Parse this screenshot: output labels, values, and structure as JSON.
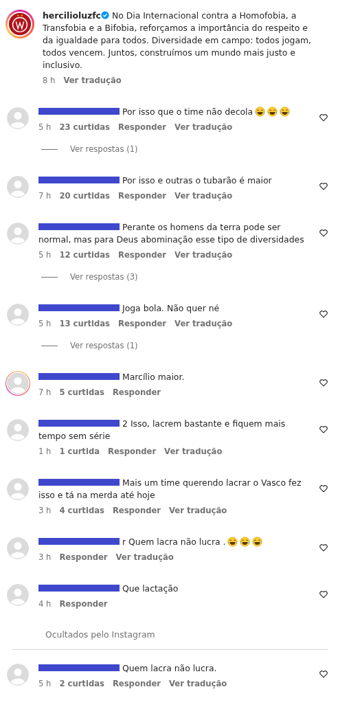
{
  "post": {
    "username": "hercilioluzfc",
    "verified": true,
    "caption": "No Dia Internacional contra a Homofobia, a Transfobia e a Bifobia, reforçamos a importância do respeito e da igualdade para todos. Diversidade em campo: todos jogam, todos vencem. Juntos, construímos um mundo mais justo e inclusivo.",
    "time": "8 h",
    "translate": "Ver tradução"
  },
  "comments": [
    {
      "text": "Por isso que o time não decola",
      "emojis": [
        {
          "kind": "tears-of-joy"
        },
        {
          "kind": "tears-of-joy"
        },
        {
          "kind": "tears-of-joy"
        }
      ],
      "story_ring": false,
      "time": "5 h",
      "likes": "23 curtidas",
      "reply": "Responder",
      "translate": "Ver tradução",
      "replies": "Ver respostas (1)"
    },
    {
      "text": "Por isso e outras o tubarão é maior",
      "story_ring": false,
      "time": "7 h",
      "likes": "20 curtidas",
      "reply": "Responder",
      "translate": "Ver tradução"
    },
    {
      "text": "Perante os homens da terra pode ser normal, mas para Deus abominação esse tipo de diversidades",
      "story_ring": false,
      "time": "5 h",
      "likes": "12 curtidas",
      "reply": "Responder",
      "translate": "Ver tradução",
      "replies": "Ver respostas (3)"
    },
    {
      "text": "Joga bola. Não quer né",
      "story_ring": false,
      "time": "5 h",
      "likes": "13 curtidas",
      "reply": "Responder",
      "translate": "Ver tradução",
      "replies": "Ver respostas (1)"
    },
    {
      "text": "Marcílio maior.",
      "story_ring": true,
      "time": "7 h",
      "likes": "5 curtidas",
      "reply": "Responder"
    },
    {
      "username_tail": "2",
      "text": "Isso, lacrem bastante e fiquem mais tempo sem série",
      "story_ring": false,
      "time": "1 h",
      "likes": "1 curtida",
      "reply": "Responder",
      "translate": "Ver tradução"
    },
    {
      "text": "Mais um time querendo lacrar o Vasco fez isso e tá na merda até hoje",
      "story_ring": false,
      "time": "3 h",
      "likes": "4 curtidas",
      "reply": "Responder",
      "translate": "Ver tradução"
    },
    {
      "username_tail": "r",
      "text": "Quem lacra não lucra .",
      "emojis": [
        {
          "kind": "tears-of-joy"
        },
        {
          "kind": "tears-of-joy"
        },
        {
          "kind": "tears-of-joy"
        }
      ],
      "story_ring": false,
      "time": "3 h",
      "reply": "Responder",
      "translate": "Ver tradução"
    },
    {
      "text": "Que lactação",
      "story_ring": false,
      "time": "4 h",
      "reply": "Responder"
    }
  ],
  "hidden_label": "Ocultados pelo Instagram",
  "hidden_comments": [
    {
      "text": "Quem lacra não lucra.",
      "story_ring": false,
      "time": "5 h",
      "likes": "2 curtidas",
      "reply": "Responder",
      "translate": "Ver tradução"
    }
  ]
}
